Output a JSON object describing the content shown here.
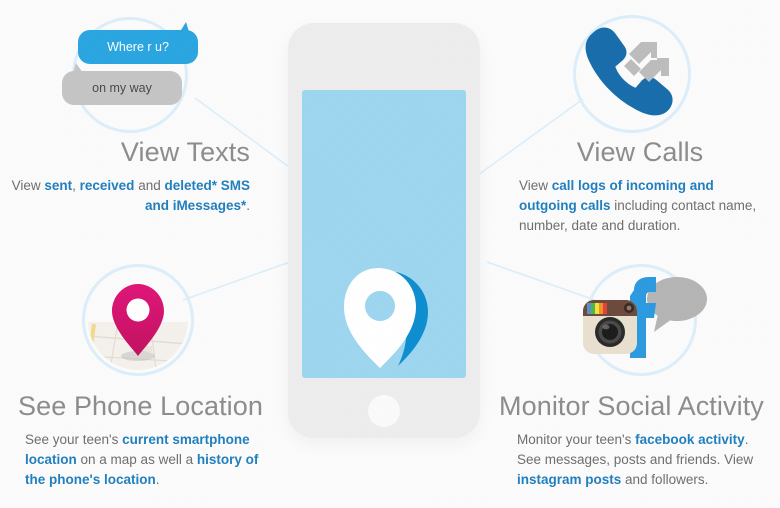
{
  "page": {
    "background_color": "#fbfbfb",
    "accent_blue": "#2280bf",
    "heading_gray": "#8d8d8d",
    "body_gray": "#6f6f6f",
    "screen_blue": "#9ed6ef",
    "ring_blue": "#dceefa",
    "pin_pink": "#d81b60",
    "phone_icon_blue": "#1a6eab",
    "facebook_blue": "#2e9ae0"
  },
  "texts_feature": {
    "heading": "View Texts",
    "body_parts": [
      {
        "text": "View ",
        "bold": false
      },
      {
        "text": "sent",
        "bold": true
      },
      {
        "text": ", ",
        "bold": false
      },
      {
        "text": "received",
        "bold": true
      },
      {
        "text": " and ",
        "bold": false
      },
      {
        "text": "deleted* SMS and iMessages*",
        "bold": true
      },
      {
        "text": ".",
        "bold": false
      }
    ],
    "bubbles": [
      {
        "id": "outgoing",
        "text": "Where r u?",
        "style": "blue"
      },
      {
        "id": "incoming",
        "text": "on my way",
        "style": "gray"
      }
    ]
  },
  "calls_feature": {
    "heading": "View Calls",
    "body_parts": [
      {
        "text": "View ",
        "bold": false
      },
      {
        "text": "call logs of incoming and outgoing calls",
        "bold": true
      },
      {
        "text": " including contact name, number, date and duration.",
        "bold": false
      }
    ],
    "icon": "phone-call-icon"
  },
  "location_feature": {
    "heading": "See Phone Location",
    "body_parts": [
      {
        "text": "See your teen's ",
        "bold": false
      },
      {
        "text": "current smartphone location",
        "bold": true
      },
      {
        "text": " on a map as well a ",
        "bold": false
      },
      {
        "text": "history of the phone's location",
        "bold": true
      },
      {
        "text": ".",
        "bold": false
      }
    ],
    "icon": "map-pin-icon"
  },
  "social_feature": {
    "heading": "Monitor Social Activity",
    "body_parts": [
      {
        "text": "Monitor your teen's ",
        "bold": false
      },
      {
        "text": "facebook activity",
        "bold": true
      },
      {
        "text": ". See messages, posts and friends. View ",
        "bold": false
      },
      {
        "text": "instagram posts",
        "bold": true
      },
      {
        "text": " and followers.",
        "bold": false
      }
    ],
    "icons": [
      "instagram-icon",
      "facebook-icon",
      "speech-bubble-icon"
    ]
  },
  "device": {
    "name": "smartphone-mockup",
    "screen_logo": "location-pin-logo"
  }
}
